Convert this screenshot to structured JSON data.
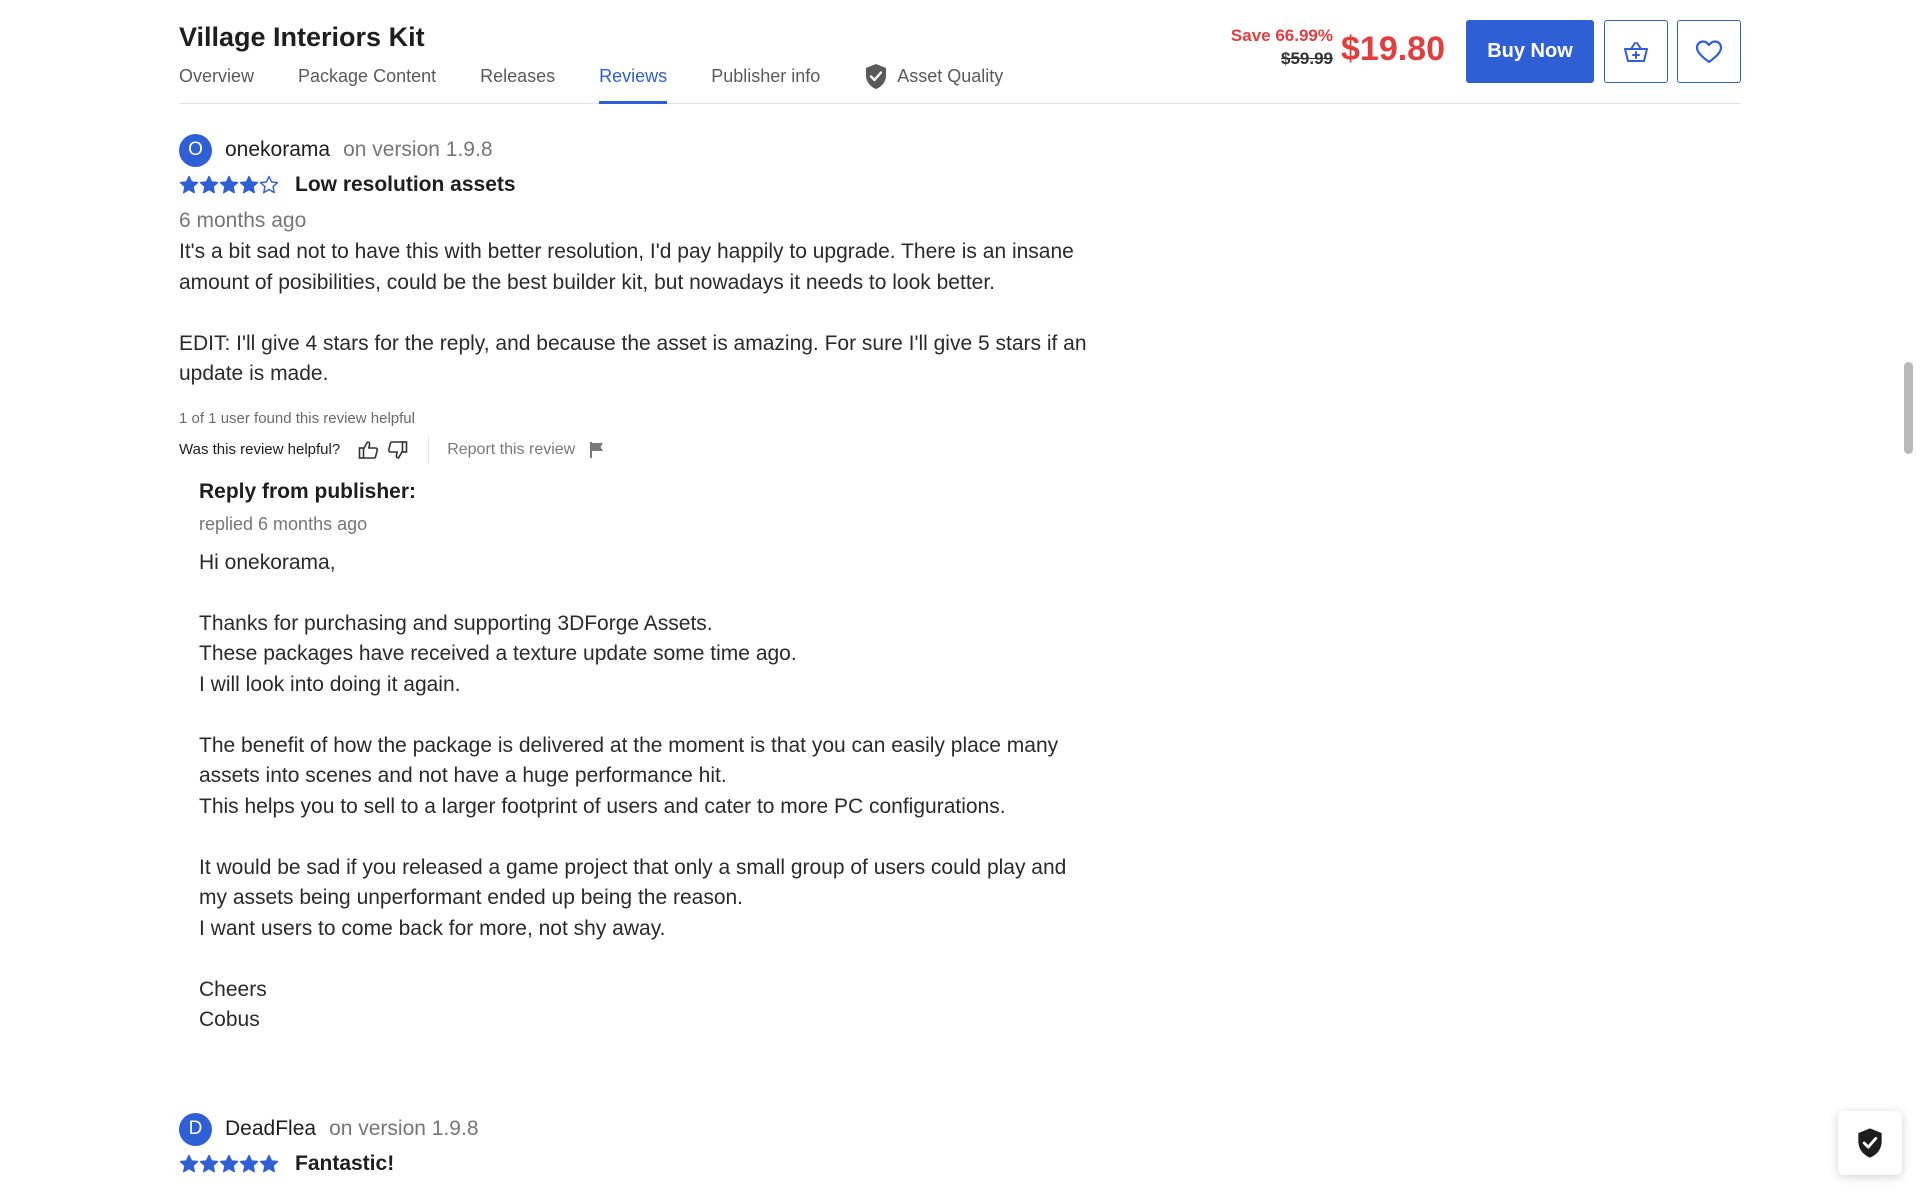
{
  "header": {
    "title": "Village Interiors Kit",
    "tabs": [
      {
        "label": "Overview",
        "active": false
      },
      {
        "label": "Package Content",
        "active": false
      },
      {
        "label": "Releases",
        "active": false
      },
      {
        "label": "Reviews",
        "active": true
      },
      {
        "label": "Publisher info",
        "active": false
      },
      {
        "label": "Asset Quality",
        "active": false,
        "icon": "shield-check-icon"
      }
    ],
    "save_text": "Save 66.99%",
    "old_price": "$59.99",
    "price": "$19.80",
    "buy_label": "Buy Now",
    "cart_icon": "add-to-cart-icon",
    "wishlist_icon": "heart-icon"
  },
  "colors": {
    "accent": "#2f5fd4",
    "sale": "#e23e3e",
    "muted": "#767676"
  },
  "reviews": [
    {
      "avatar_letter": "O",
      "username": "onekorama",
      "version": "on version 1.9.8",
      "rating": 4,
      "max_rating": 5,
      "title": "Low resolution assets",
      "date": "6 months ago",
      "body": "It's a bit sad not to have this with better resolution, I'd pay happily to upgrade. There is an insane\namount of posibilities, could be the best builder kit, but nowadays it needs to look better.\n\nEDIT: I'll give 4 stars for the reply, and because the asset is amazing. For sure I'll give 5 stars if an\nupdate is made.",
      "helpful_count": "1 of 1 user found this review helpful",
      "helpful_question": "Was this review helpful?",
      "report_label": "Report this review",
      "reply": {
        "title": "Reply from publisher:",
        "date": "replied 6 months ago",
        "body": "Hi onekorama,\n\nThanks for purchasing and supporting 3DForge Assets.\nThese packages have received a texture update some time ago.\nI will look into doing it again.\n\nThe benefit of how the package is delivered at the moment is that you can easily place many\nassets into scenes and not have a huge performance hit.\nThis helps you to sell to a larger footprint of users and cater to more PC configurations.\n\nIt would be sad if you released a game project that only a small group of users could play and\nmy assets being unperformant ended up being the reason.\nI want users to come back for more, not shy away.\n\nCheers\nCobus"
      }
    },
    {
      "avatar_letter": "D",
      "username": "DeadFlea",
      "version": "on version 1.9.8",
      "rating": 5,
      "max_rating": 5,
      "title": "Fantastic!"
    }
  ]
}
